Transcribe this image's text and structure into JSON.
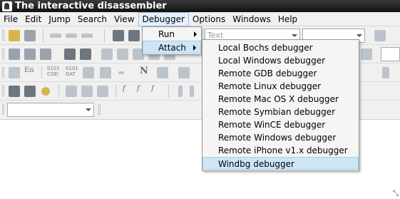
{
  "window": {
    "title": "The interactive disassembler"
  },
  "menubar": {
    "items": [
      {
        "label": "File"
      },
      {
        "label": "Edit"
      },
      {
        "label": "Jump"
      },
      {
        "label": "Search"
      },
      {
        "label": "View"
      },
      {
        "label": "Debugger"
      },
      {
        "label": "Options"
      },
      {
        "label": "Windows"
      },
      {
        "label": "Help"
      }
    ]
  },
  "toolbar": {
    "text_combo_placeholder": "Text",
    "font_button_label": "En",
    "bytes_cod_label": "0101 COD",
    "bytes_dat_label": "0101 DAT",
    "italic_f_label": "f",
    "letter_n_label": "N"
  },
  "debugger_menu": {
    "items": [
      {
        "label": "Run"
      },
      {
        "label": "Attach"
      }
    ]
  },
  "attach_submenu": {
    "items": [
      {
        "label": "Local Bochs debugger"
      },
      {
        "label": "Local Windows debugger"
      },
      {
        "label": "Remote GDB debugger"
      },
      {
        "label": "Remote Linux debugger"
      },
      {
        "label": "Remote Mac OS X debugger"
      },
      {
        "label": "Remote Symbian debugger"
      },
      {
        "label": "Remote WinCE debugger"
      },
      {
        "label": "Remote Windows debugger"
      },
      {
        "label": "Remote iPhone v1.x debugger"
      },
      {
        "label": "Windbg debugger"
      }
    ],
    "highlighted": "Windbg debugger"
  },
  "colors": {
    "highlight": "#cde6f7",
    "titlebar": "#111111",
    "menu_bg": "#f5f5f5"
  }
}
